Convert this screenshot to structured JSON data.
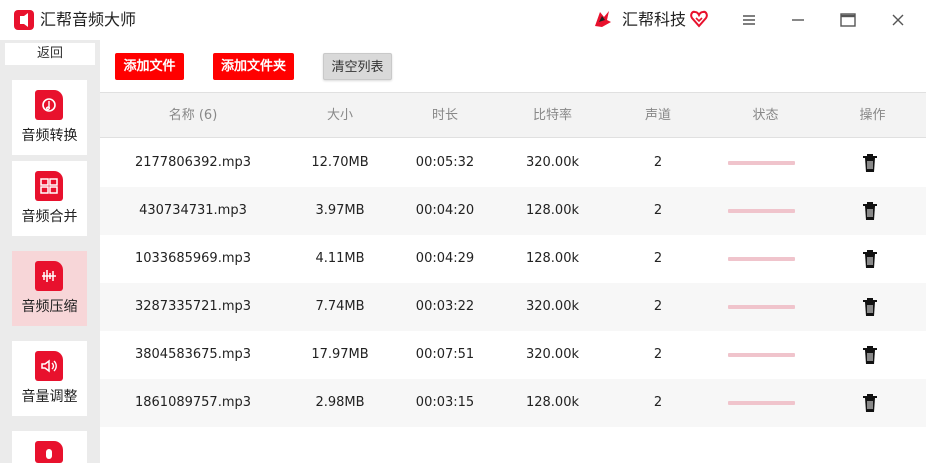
{
  "app": {
    "title": "汇帮音频大师",
    "logo_icon": "music-app-icon"
  },
  "brand": {
    "name": "汇帮科技",
    "logo_icon": "brand-logo-icon",
    "heart_icon": "heart-badge-icon",
    "color": "#e8112d"
  },
  "window_controls": [
    "menu-icon",
    "minimize-icon",
    "maximize-icon",
    "close-icon"
  ],
  "sidebar": {
    "back_label": "返回",
    "items": [
      {
        "label": "音频转换",
        "icon": "audio-convert-icon",
        "active": false
      },
      {
        "label": "音频合并",
        "icon": "audio-merge-icon",
        "active": false
      },
      {
        "label": "音频压缩",
        "icon": "audio-compress-icon",
        "active": true
      },
      {
        "label": "音量调整",
        "icon": "volume-adjust-icon",
        "active": false
      },
      {
        "label": "",
        "icon": "microphone-icon",
        "active": false
      }
    ]
  },
  "toolbar": {
    "add_file": "添加文件",
    "add_folder": "添加文件夹",
    "clear_list": "清空列表"
  },
  "table": {
    "headers": {
      "name": "名称 (6)",
      "size": "大小",
      "duration": "时长",
      "bitrate": "比特率",
      "channels": "声道",
      "status": "状态",
      "action": "操作"
    },
    "rows": [
      {
        "name": "2177806392.mp3",
        "size": "12.70MB",
        "duration": "00:05:32",
        "bitrate": "320.00k",
        "channels": "2"
      },
      {
        "name": "430734731.mp3",
        "size": "3.97MB",
        "duration": "00:04:20",
        "bitrate": "128.00k",
        "channels": "2"
      },
      {
        "name": "1033685969.mp3",
        "size": "4.11MB",
        "duration": "00:04:29",
        "bitrate": "128.00k",
        "channels": "2"
      },
      {
        "name": "3287335721.mp3",
        "size": "7.74MB",
        "duration": "00:03:22",
        "bitrate": "320.00k",
        "channels": "2"
      },
      {
        "name": "3804583675.mp3",
        "size": "17.97MB",
        "duration": "00:07:51",
        "bitrate": "320.00k",
        "channels": "2"
      },
      {
        "name": "1861089757.mp3",
        "size": "2.98MB",
        "duration": "00:03:15",
        "bitrate": "128.00k",
        "channels": "2"
      }
    ]
  },
  "colors": {
    "accent": "#ff0000",
    "sidebar_bg": "#ebebeb",
    "active_item_bg": "#f7d6d8",
    "status_bar": "#f0c4cc"
  }
}
